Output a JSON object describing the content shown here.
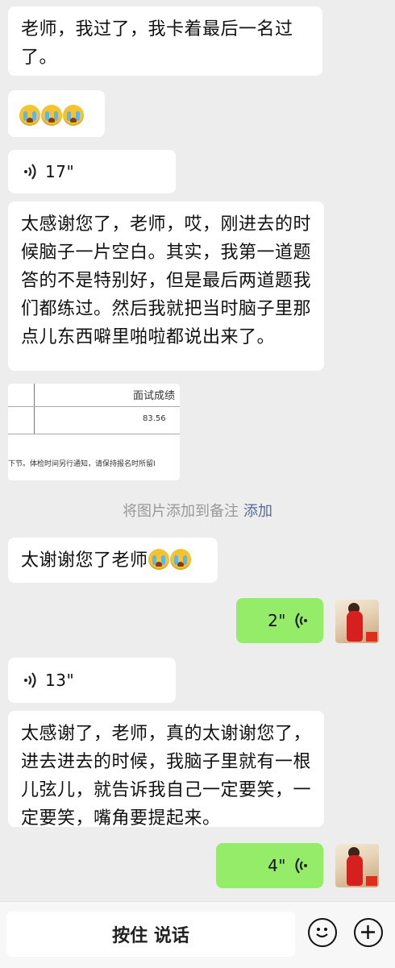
{
  "messages": [
    {
      "text": "老师，我过了，我卡着最后一名过了。"
    },
    {
      "emoji": "crying-emoji x3"
    },
    {
      "duration": "17\""
    },
    {
      "text": "太感谢您了，老师，哎，刚进去的时候脑子一片空白。其实，我第一道题答的不是特别好，但是最后两道题我们都练过。然后我就把当时脑子里那点儿东西噼里啪啦都说出来了。"
    },
    {
      "doc": {
        "header": "面试成绩",
        "score": "83.56",
        "note": "下节。体检时间另行通知，请保持报名时所留I"
      }
    },
    {
      "text": "太谢谢您了老师"
    },
    {
      "duration": "2\""
    },
    {
      "duration": "13\""
    },
    {
      "text": "太感谢了，老师，真的太谢谢您了，进去进去的时候，我脑子里就有一根儿弦儿，就告诉我自己一定要笑，一定要笑，嘴角要提起来。"
    },
    {
      "duration": "4\""
    }
  ],
  "hint": {
    "text": "将图片添加到备注",
    "link": "添加"
  },
  "input": {
    "hold_to_talk": "按住 说话"
  },
  "colors": {
    "sent_bubble": "#95ec69",
    "received_bubble": "#ffffff",
    "background": "#ededed",
    "link": "#576b95"
  }
}
